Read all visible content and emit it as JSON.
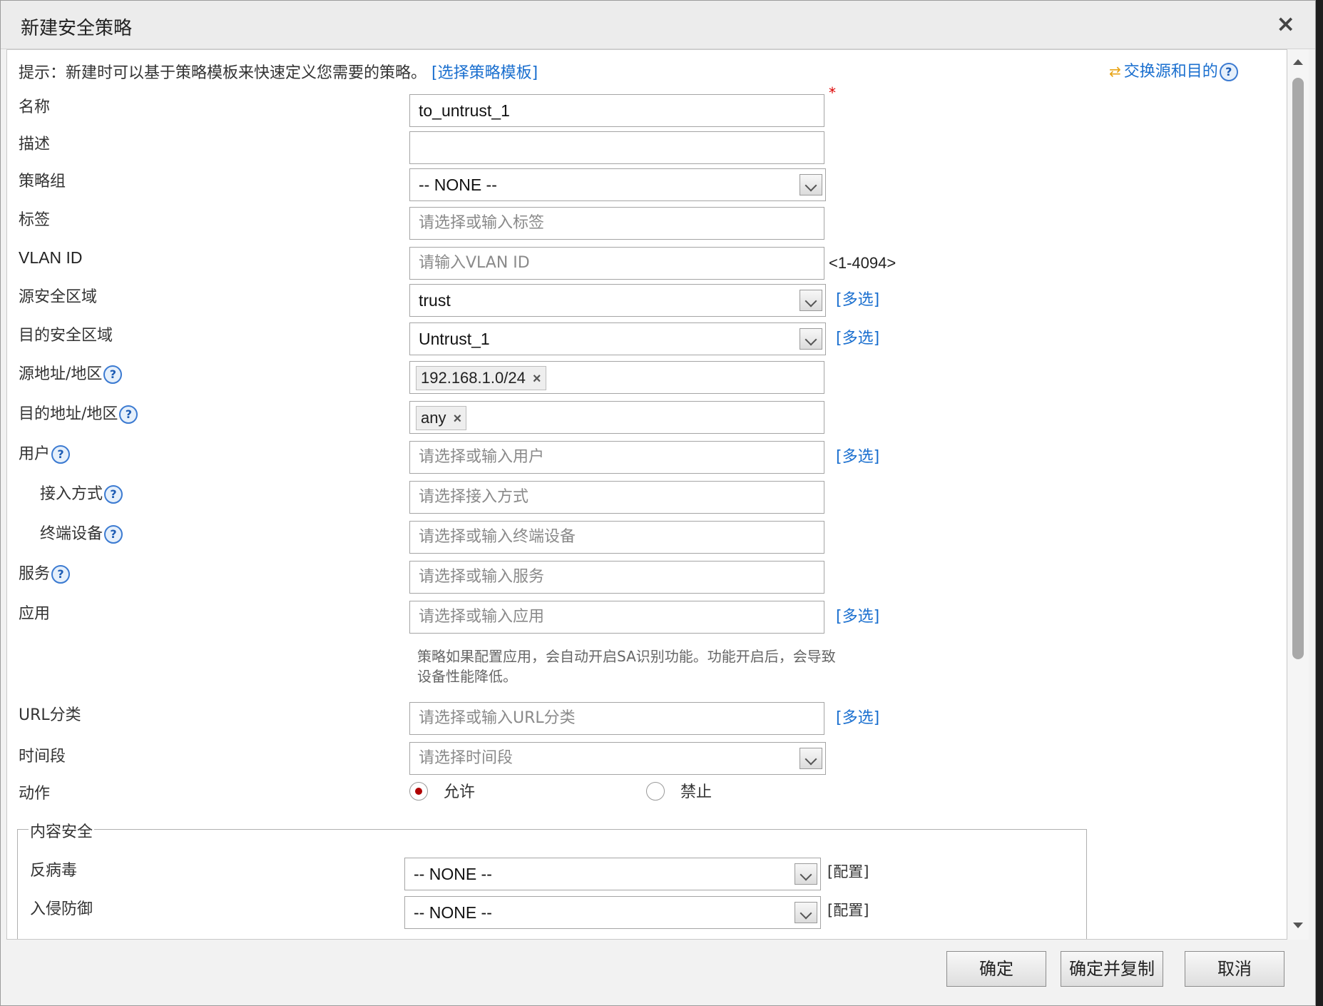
{
  "dialog": {
    "title": "新建安全策略",
    "close_symbol": "×"
  },
  "hint": {
    "text": "提示：新建时可以基于策略模板来快速定义您需要的策略。",
    "template_link": "[选择策略模板]",
    "swap_label": "交换源和目的"
  },
  "form": {
    "name": {
      "label": "名称",
      "value": "to_untrust_1",
      "required_mark": "*"
    },
    "description": {
      "label": "描述",
      "value": ""
    },
    "policy_group": {
      "label": "策略组",
      "value": "-- NONE --"
    },
    "tag": {
      "label": "标签",
      "placeholder": "请选择或输入标签"
    },
    "vlan_id": {
      "label": "VLAN ID",
      "placeholder": "请输入VLAN ID",
      "range": "<1-4094>"
    },
    "source_zone": {
      "label": "源安全区域",
      "value": "trust",
      "multi": "[多选]"
    },
    "dest_zone": {
      "label": "目的安全区域",
      "value": "Untrust_1",
      "multi": "[多选]"
    },
    "source_address": {
      "label": "源地址/地区",
      "tag": "192.168.1.0/24"
    },
    "dest_address": {
      "label": "目的地址/地区",
      "tag": "any"
    },
    "user": {
      "label": "用户",
      "placeholder": "请选择或输入用户",
      "multi": "[多选]"
    },
    "access_mode": {
      "label": "接入方式",
      "placeholder": "请选择接入方式"
    },
    "terminal_device": {
      "label": "终端设备",
      "placeholder": "请选择或输入终端设备"
    },
    "service": {
      "label": "服务",
      "placeholder": "请选择或输入服务"
    },
    "application": {
      "label": "应用",
      "placeholder": "请选择或输入应用",
      "multi": "[多选]"
    },
    "app_note": "策略如果配置应用，会自动开启SA识别功能。功能开启后，会导致设备性能降低。",
    "url_category": {
      "label": "URL分类",
      "placeholder": "请选择或输入URL分类",
      "multi": "[多选]"
    },
    "time_range": {
      "label": "时间段",
      "placeholder": "请选择时间段"
    },
    "action": {
      "label": "动作",
      "allow": "允许",
      "deny": "禁止",
      "selected": "允许"
    }
  },
  "content_security": {
    "legend": "内容安全",
    "antivirus": {
      "label": "反病毒",
      "value": "-- NONE --",
      "config": "[配置]"
    },
    "ips": {
      "label": "入侵防御",
      "value": "-- NONE --",
      "config": "[配置]"
    }
  },
  "buttons": {
    "ok": "确定",
    "ok_copy": "确定并复制",
    "cancel": "取消"
  },
  "icons": {
    "help": "?",
    "tag_remove": "×",
    "swap": "⇄"
  },
  "colors": {
    "link": "#1a6fcf",
    "required": "#dd0000",
    "radio_selected": "#b00000"
  }
}
